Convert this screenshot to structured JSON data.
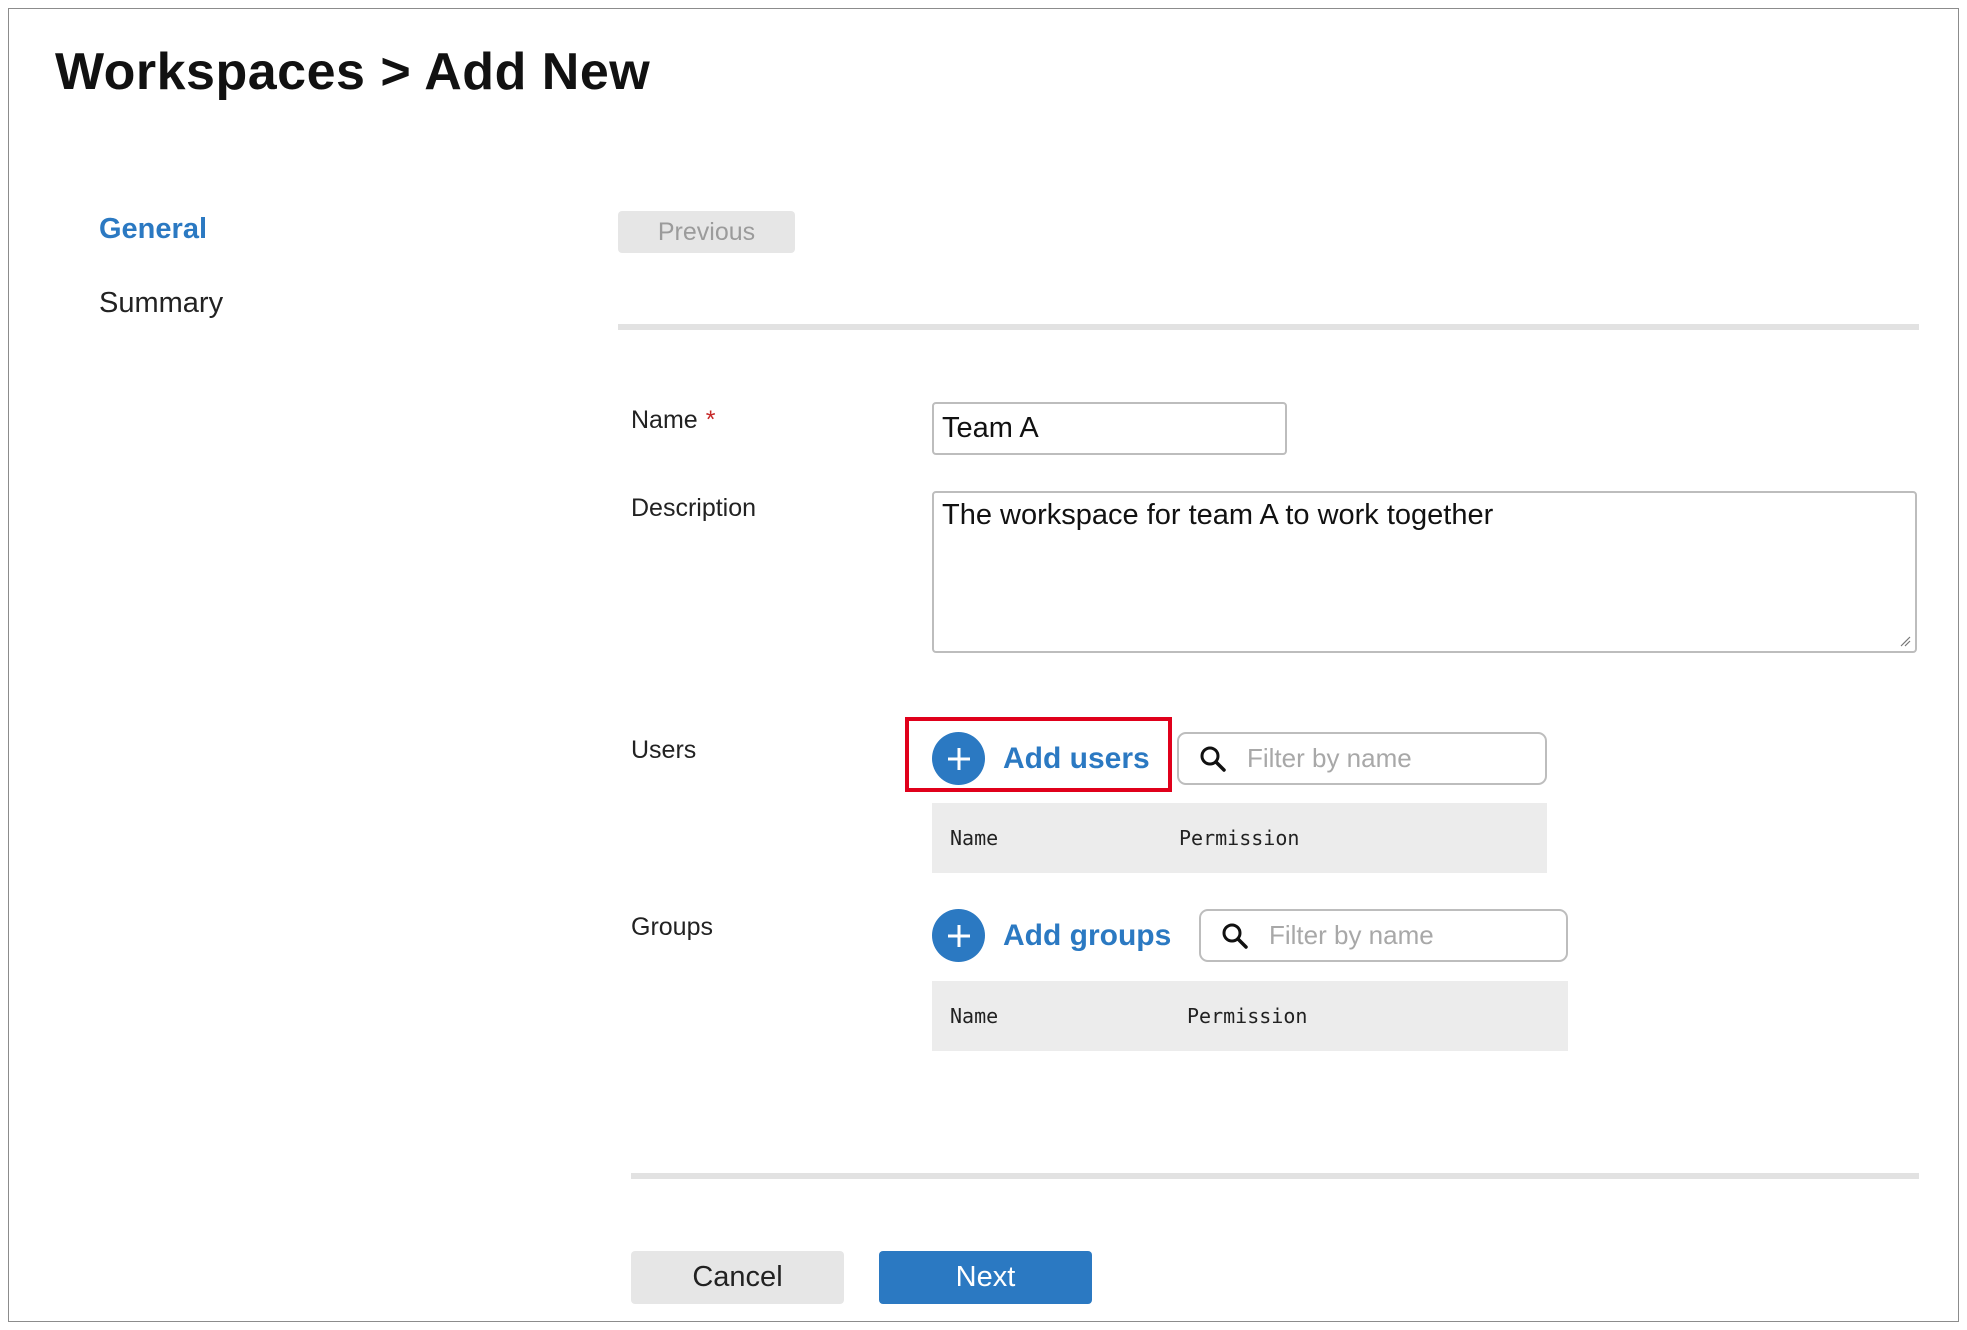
{
  "header": {
    "title": "Workspaces > Add New"
  },
  "nav": {
    "items": [
      {
        "label": "General",
        "active": true
      },
      {
        "label": "Summary",
        "active": false
      }
    ]
  },
  "wizard": {
    "previous_label": "Previous",
    "cancel_label": "Cancel",
    "next_label": "Next"
  },
  "form": {
    "name": {
      "label": "Name",
      "required_mark": "*",
      "value": "Team A"
    },
    "description": {
      "label": "Description",
      "value": "The workspace for team A to work together"
    },
    "users": {
      "label": "Users",
      "add_label": "Add users",
      "filter_placeholder": "Filter by name",
      "columns": [
        "Name",
        "Permission"
      ]
    },
    "groups": {
      "label": "Groups",
      "add_label": "Add groups",
      "filter_placeholder": "Filter by name",
      "columns": [
        "Name",
        "Permission"
      ]
    }
  },
  "colors": {
    "accent": "#2b79c2",
    "highlight": "#e0001b",
    "required": "#c62828"
  },
  "icons": {
    "add": "plus-circle-icon",
    "filter": "search-icon"
  }
}
